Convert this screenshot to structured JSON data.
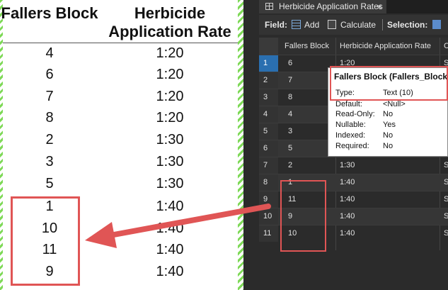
{
  "left_table": {
    "headers": {
      "blocks": "Fallers Block",
      "rate_line1": "Herbicide",
      "rate_line2": "Application Rate"
    },
    "rows": [
      {
        "block": "4",
        "rate": "1:20"
      },
      {
        "block": "6",
        "rate": "1:20"
      },
      {
        "block": "7",
        "rate": "1:20"
      },
      {
        "block": "8",
        "rate": "1:20"
      },
      {
        "block": "2",
        "rate": "1:30"
      },
      {
        "block": "3",
        "rate": "1:30"
      },
      {
        "block": "5",
        "rate": "1:30"
      },
      {
        "block": "1",
        "rate": "1:40"
      },
      {
        "block": "10",
        "rate": "1:40"
      },
      {
        "block": "11",
        "rate": "1:40"
      },
      {
        "block": "9",
        "rate": "1:40"
      }
    ]
  },
  "attribute_table": {
    "tab_title": "Herbicide Application Rates",
    "tab_close": "×",
    "toolbar": {
      "field_label": "Field:",
      "add_label": "Add",
      "calculate_label": "Calculate",
      "selection_label": "Selection:"
    },
    "columns": {
      "c1": "Fallers Block",
      "c2": "Herbicide Application Rate",
      "c3": "C"
    },
    "rows": [
      {
        "n": "1",
        "block": "6",
        "rate": "1:20",
        "c3": "S"
      },
      {
        "n": "2",
        "block": "7",
        "rate": "",
        "c3": "S"
      },
      {
        "n": "3",
        "block": "8",
        "rate": "",
        "c3": "S"
      },
      {
        "n": "4",
        "block": "4",
        "rate": "",
        "c3": "S"
      },
      {
        "n": "5",
        "block": "3",
        "rate": "",
        "c3": "S"
      },
      {
        "n": "6",
        "block": "5",
        "rate": "",
        "c3": "S"
      },
      {
        "n": "7",
        "block": "2",
        "rate": "1:30",
        "c3": "S"
      },
      {
        "n": "8",
        "block": "1",
        "rate": "1:40",
        "c3": "S"
      },
      {
        "n": "9",
        "block": "11",
        "rate": "1:40",
        "c3": "S"
      },
      {
        "n": "10",
        "block": "9",
        "rate": "1:40",
        "c3": "S"
      },
      {
        "n": "11",
        "block": "10",
        "rate": "1:40",
        "c3": "S"
      }
    ]
  },
  "field_popup": {
    "title": "Fallers Block (Fallers_Block)",
    "props": [
      {
        "label": "Type:",
        "value": "Text (10)"
      },
      {
        "label": "Default:",
        "value": "<Null>"
      },
      {
        "label": "Read-Only:",
        "value": "No"
      },
      {
        "label": "Nullable:",
        "value": "Yes"
      },
      {
        "label": "Indexed:",
        "value": "No"
      },
      {
        "label": "Required:",
        "value": "No"
      }
    ]
  },
  "colors": {
    "highlight": "#e05555",
    "selected_row": "#2a6fb0",
    "hatch": "#7ed957"
  }
}
